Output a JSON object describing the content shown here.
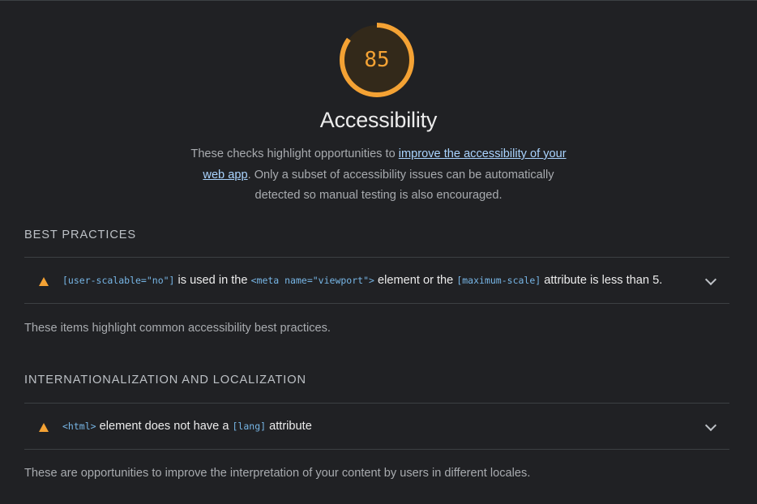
{
  "score": {
    "value": "85",
    "fraction": 0.85,
    "color": "#f4a234"
  },
  "category": {
    "title": "Accessibility",
    "description_before": "These checks highlight opportunities to ",
    "link_text": "improve the accessibility of your web app",
    "description_after": ". Only a subset of accessibility issues can be automatically detected so manual testing is also encouraged."
  },
  "groups": [
    {
      "header": "BEST PRACTICES",
      "audit": {
        "icon": "warning-triangle-icon",
        "code1": "[user-scalable=\"no\"]",
        "text1": " is used in the ",
        "code2": "<meta name=\"viewport\">",
        "text2": " element or the ",
        "code3": "[maximum-scale]",
        "text3": " attribute is less than 5."
      },
      "description": "These items highlight common accessibility best practices."
    },
    {
      "header": "INTERNATIONALIZATION AND LOCALIZATION",
      "audit": {
        "icon": "warning-triangle-icon",
        "code1": "<html>",
        "text1": " element does not have a ",
        "code2": "[lang]",
        "text2": " attribute"
      },
      "description": "These are opportunities to improve the interpretation of your content by users in different locales."
    }
  ],
  "colors": {
    "background": "#202124",
    "warning": "#f4a234",
    "link": "#aad4ff",
    "code": "#77b6e6"
  }
}
